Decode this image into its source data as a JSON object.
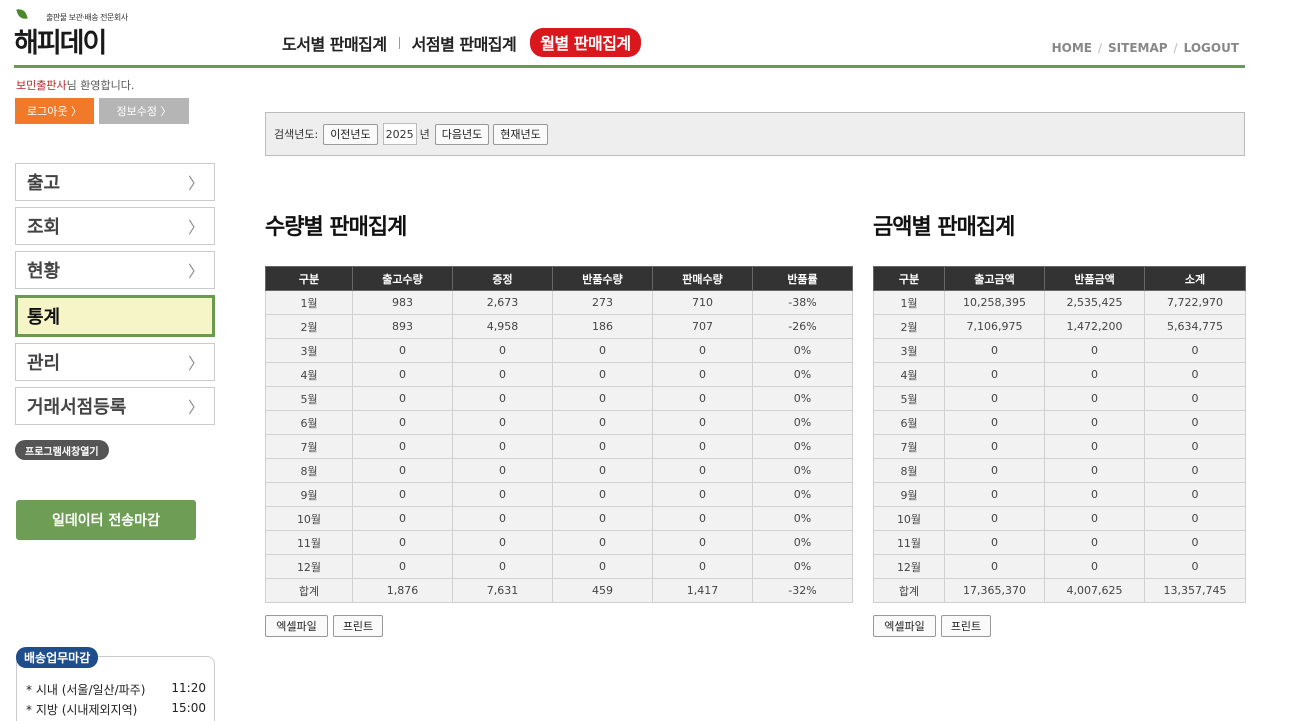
{
  "header": {
    "tagline": "출판물 보관·배송 전문회사",
    "brand": "해피데이",
    "nav": [
      "도서별 판매집계",
      "서점별 판매집계"
    ],
    "nav_active": "월별 판매집계",
    "util": [
      "HOME",
      "SITEMAP",
      "LOGOUT"
    ]
  },
  "sidebar": {
    "welcome_name": "보민출판사",
    "welcome_suffix": "님 환영합니다.",
    "logout_btn": "로그아웃 〉",
    "info_btn": "정보수정 〉",
    "menu": [
      {
        "label": "출고",
        "active": false
      },
      {
        "label": "조회",
        "active": false
      },
      {
        "label": "현황",
        "active": false
      },
      {
        "label": "통계",
        "active": true
      },
      {
        "label": "관리",
        "active": false
      },
      {
        "label": "거래서점등록",
        "active": false
      }
    ],
    "new_window": "프로그램새창열기",
    "close_btn": "일데이터 전송마감",
    "shipping": {
      "title": "배송업무마감",
      "rows": [
        {
          "label": "* 시내 (서울/일산/파주)",
          "time": "11:20"
        },
        {
          "label": "* 지방 (시내제외지역)",
          "time": "15:00"
        }
      ]
    }
  },
  "search": {
    "label": "검색년도:",
    "prev": "이전년도",
    "year": "2025",
    "unit": "년",
    "next": "다음년도",
    "current": "현재년도"
  },
  "qty": {
    "title": "수량별 판매집계",
    "headers": [
      "구분",
      "출고수량",
      "증정",
      "반품수량",
      "판매수량",
      "반품률"
    ],
    "rows": [
      [
        "1월",
        "983",
        "2,673",
        "273",
        "710",
        "-38%"
      ],
      [
        "2월",
        "893",
        "4,958",
        "186",
        "707",
        "-26%"
      ],
      [
        "3월",
        "0",
        "0",
        "0",
        "0",
        "0%"
      ],
      [
        "4월",
        "0",
        "0",
        "0",
        "0",
        "0%"
      ],
      [
        "5월",
        "0",
        "0",
        "0",
        "0",
        "0%"
      ],
      [
        "6월",
        "0",
        "0",
        "0",
        "0",
        "0%"
      ],
      [
        "7월",
        "0",
        "0",
        "0",
        "0",
        "0%"
      ],
      [
        "8월",
        "0",
        "0",
        "0",
        "0",
        "0%"
      ],
      [
        "9월",
        "0",
        "0",
        "0",
        "0",
        "0%"
      ],
      [
        "10월",
        "0",
        "0",
        "0",
        "0",
        "0%"
      ],
      [
        "11월",
        "0",
        "0",
        "0",
        "0",
        "0%"
      ],
      [
        "12월",
        "0",
        "0",
        "0",
        "0",
        "0%"
      ],
      [
        "합계",
        "1,876",
        "7,631",
        "459",
        "1,417",
        "-32%"
      ]
    ],
    "excel": "엑셀파일",
    "print": "프린트"
  },
  "amount": {
    "title": "금액별 판매집계",
    "headers": [
      "구분",
      "출고금액",
      "반품금액",
      "소계"
    ],
    "rows": [
      [
        "1월",
        "10,258,395",
        "2,535,425",
        "7,722,970"
      ],
      [
        "2월",
        "7,106,975",
        "1,472,200",
        "5,634,775"
      ],
      [
        "3월",
        "0",
        "0",
        "0"
      ],
      [
        "4월",
        "0",
        "0",
        "0"
      ],
      [
        "5월",
        "0",
        "0",
        "0"
      ],
      [
        "6월",
        "0",
        "0",
        "0"
      ],
      [
        "7월",
        "0",
        "0",
        "0"
      ],
      [
        "8월",
        "0",
        "0",
        "0"
      ],
      [
        "9월",
        "0",
        "0",
        "0"
      ],
      [
        "10월",
        "0",
        "0",
        "0"
      ],
      [
        "11월",
        "0",
        "0",
        "0"
      ],
      [
        "12월",
        "0",
        "0",
        "0"
      ],
      [
        "합계",
        "17,365,370",
        "4,007,625",
        "13,357,745"
      ]
    ],
    "excel": "엑셀파일",
    "print": "프린트"
  }
}
